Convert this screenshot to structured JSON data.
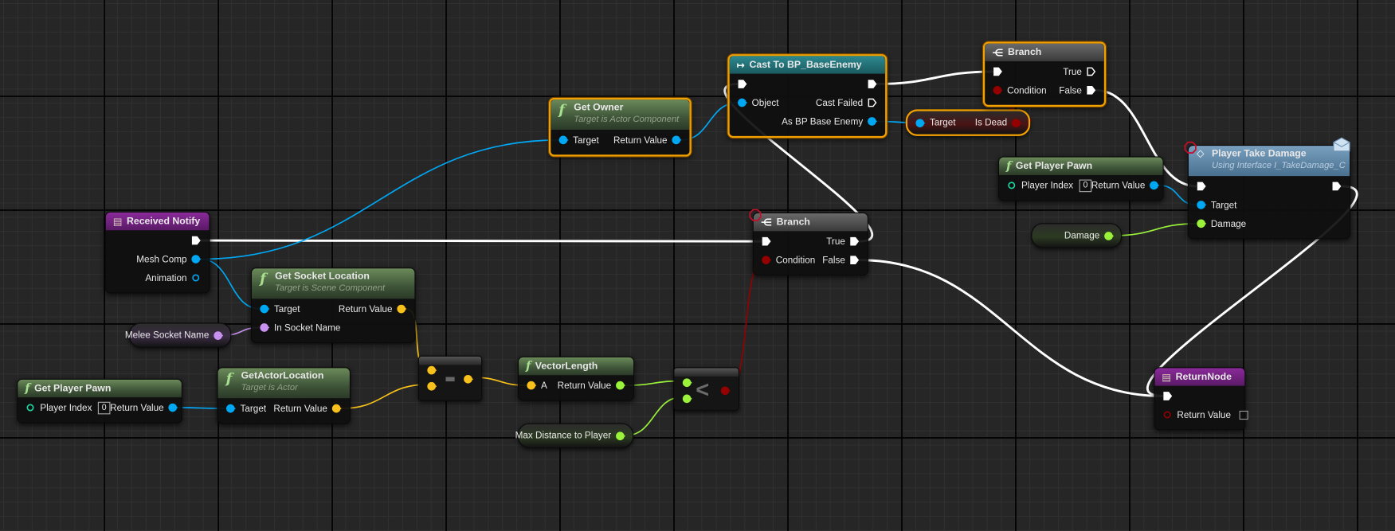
{
  "pin_colors": {
    "exec": "#ffffff",
    "object": "#00a8f4",
    "vector": "#f7c01a",
    "bool": "#950000",
    "float": "#9af23a",
    "name": "#c890f0",
    "int": "#1ed6a0"
  },
  "accent_selected": "#f2a000",
  "breakpoint_color": "#c0102a",
  "nodes": [
    {
      "id": "get_owner",
      "kind": "function",
      "style": "function",
      "icon": "function-icon",
      "icon_glyph": "f",
      "title": "Get Owner",
      "subtitle": "Target is Actor Component",
      "selected": true,
      "rows": [
        {
          "in": {
            "id": "target",
            "label": "Target",
            "type": "object",
            "connected": true
          },
          "out": {
            "id": "ret",
            "label": "Return Value",
            "type": "object",
            "connected": true
          }
        }
      ]
    },
    {
      "id": "cast",
      "kind": "function",
      "style": "cast",
      "icon": "cast-icon",
      "icon_glyph": "↦",
      "title": "Cast To BP_BaseEnemy",
      "selected": true,
      "rows": [
        {
          "in": {
            "id": "exec_in",
            "label": "",
            "type": "exec",
            "connected": true
          },
          "out": {
            "id": "exec_out",
            "label": "",
            "type": "exec",
            "connected": true
          }
        },
        {
          "in": {
            "id": "object",
            "label": "Object",
            "type": "object",
            "connected": true
          },
          "out": {
            "id": "cast_failed",
            "label": "Cast Failed",
            "type": "exec",
            "connected": false
          }
        },
        {
          "out": {
            "id": "as_enemy",
            "label": "As BP Base Enemy",
            "type": "object",
            "connected": true
          }
        }
      ]
    },
    {
      "id": "is_dead",
      "kind": "pure",
      "tint": "#4a1414",
      "selected": true,
      "in": {
        "id": "target",
        "label": "Target",
        "type": "object",
        "connected": true
      },
      "out": {
        "id": "is_dead",
        "label": "Is Dead",
        "type": "bool",
        "connected": true
      }
    },
    {
      "id": "branch_top",
      "kind": "function",
      "style": "branch",
      "icon": "branch-icon",
      "icon_glyph": "⋲",
      "title": "Branch",
      "selected": true,
      "rows": [
        {
          "in": {
            "id": "exec_in",
            "label": "",
            "type": "exec",
            "connected": true
          },
          "out": {
            "id": "true",
            "label": "True",
            "type": "exec",
            "connected": false
          }
        },
        {
          "in": {
            "id": "condition",
            "label": "Condition",
            "type": "bool",
            "connected": true
          },
          "out": {
            "id": "false",
            "label": "False",
            "type": "exec",
            "connected": true
          }
        }
      ]
    },
    {
      "id": "pawn_right",
      "kind": "function",
      "style": "function",
      "icon": "function-icon",
      "icon_glyph": "f",
      "title": "Get Player Pawn",
      "rows": [
        {
          "in": {
            "id": "player_index",
            "label": "Player Index",
            "type": "int",
            "connected": false,
            "default": "0"
          },
          "out": {
            "id": "ret",
            "label": "Return Value",
            "type": "object",
            "connected": true
          }
        }
      ]
    },
    {
      "id": "ptd",
      "kind": "function",
      "style": "interface",
      "icon": "interface-message-icon",
      "icon_glyph": "◇",
      "title": "Player Take Damage",
      "subtitle": "Using Interface I_TakeDamage_C",
      "breakpoint": true,
      "envelope": true,
      "rows": [
        {
          "in": {
            "id": "exec_in",
            "label": "",
            "type": "exec",
            "connected": true
          },
          "out": {
            "id": "exec_out",
            "label": "",
            "type": "exec",
            "connected": true
          }
        },
        {
          "in": {
            "id": "target",
            "label": "Target",
            "type": "object",
            "connected": true
          }
        },
        {
          "in": {
            "id": "damage",
            "label": "Damage",
            "type": "float",
            "connected": true
          }
        }
      ]
    },
    {
      "id": "damage_var",
      "kind": "variable",
      "tint": "#2c3a22",
      "out": {
        "id": "val",
        "label": "Damage",
        "type": "float",
        "connected": true
      }
    },
    {
      "id": "received",
      "kind": "function",
      "style": "event",
      "icon": "event-icon",
      "icon_glyph": "▤",
      "title": "Received Notify",
      "rows": [
        {
          "out": {
            "id": "exec_out",
            "label": "",
            "type": "exec",
            "connected": true
          }
        },
        {
          "out": {
            "id": "mesh_comp",
            "label": "Mesh Comp",
            "type": "object",
            "connected": true
          }
        },
        {
          "out": {
            "id": "animation",
            "label": "Animation",
            "type": "object",
            "connected": false
          }
        }
      ]
    },
    {
      "id": "branch_mid",
      "kind": "function",
      "style": "branch",
      "icon": "branch-icon",
      "icon_glyph": "⋲",
      "title": "Branch",
      "breakpoint": true,
      "rows": [
        {
          "in": {
            "id": "exec_in",
            "label": "",
            "type": "exec",
            "connected": true
          },
          "out": {
            "id": "true",
            "label": "True",
            "type": "exec",
            "connected": true
          }
        },
        {
          "in": {
            "id": "condition",
            "label": "Condition",
            "type": "bool",
            "connected": true
          },
          "out": {
            "id": "false",
            "label": "False",
            "type": "exec",
            "connected": true
          }
        }
      ]
    },
    {
      "id": "socket",
      "kind": "function",
      "style": "function",
      "icon": "function-icon",
      "icon_glyph": "f",
      "title": "Get Socket Location",
      "subtitle": "Target is Scene Component",
      "rows": [
        {
          "in": {
            "id": "target",
            "label": "Target",
            "type": "object",
            "connected": true
          },
          "out": {
            "id": "ret",
            "label": "Return Value",
            "type": "vector",
            "connected": true
          }
        },
        {
          "in": {
            "id": "socket_name",
            "label": "In Socket Name",
            "type": "name",
            "connected": true
          }
        }
      ]
    },
    {
      "id": "melee_var",
      "kind": "variable",
      "tint": "#3a2c44",
      "out": {
        "id": "val",
        "label": "Melee Socket Name",
        "type": "name",
        "connected": true
      }
    },
    {
      "id": "pawn_left",
      "kind": "function",
      "style": "function",
      "icon": "function-icon",
      "icon_glyph": "f",
      "title": "Get Player Pawn",
      "rows": [
        {
          "in": {
            "id": "player_index",
            "label": "Player Index",
            "type": "int",
            "connected": false,
            "default": "0"
          },
          "out": {
            "id": "ret",
            "label": "Return Value",
            "type": "object",
            "connected": true
          }
        }
      ]
    },
    {
      "id": "actor_loc",
      "kind": "function",
      "style": "function",
      "icon": "function-icon",
      "icon_glyph": "f",
      "title": "GetActorLocation",
      "subtitle": "Target is Actor",
      "rows": [
        {
          "in": {
            "id": "target",
            "label": "Target",
            "type": "object",
            "connected": true
          },
          "out": {
            "id": "ret",
            "label": "Return Value",
            "type": "vector",
            "connected": true
          }
        }
      ]
    },
    {
      "id": "subtract",
      "kind": "operator",
      "symbol": "-",
      "type": "vector",
      "inputs": [
        {
          "id": "a",
          "connected": true
        },
        {
          "id": "b",
          "connected": true
        }
      ],
      "out": {
        "id": "ret",
        "connected": true
      }
    },
    {
      "id": "vector_len",
      "kind": "function",
      "style": "function",
      "icon": "function-icon",
      "icon_glyph": "f",
      "title": "VectorLength",
      "rows": [
        {
          "in": {
            "id": "a",
            "label": "A",
            "type": "vector",
            "connected": true
          },
          "out": {
            "id": "ret",
            "label": "Return Value",
            "type": "float",
            "connected": true
          }
        }
      ]
    },
    {
      "id": "less",
      "kind": "operator",
      "symbol": "<",
      "type": "float",
      "out_type": "bool",
      "inputs": [
        {
          "id": "a",
          "connected": true
        },
        {
          "id": "b",
          "connected": true
        }
      ],
      "out": {
        "id": "ret",
        "connected": true
      }
    },
    {
      "id": "max_dist",
      "kind": "variable",
      "tint": "#2c3a22",
      "out": {
        "id": "val",
        "label": "Max Distance to Player",
        "type": "float",
        "connected": true
      }
    },
    {
      "id": "return_node",
      "kind": "function",
      "style": "return",
      "icon": "return-node-icon",
      "icon_glyph": "▤",
      "title": "ReturnNode",
      "rows": [
        {
          "in": {
            "id": "exec_in",
            "label": "",
            "type": "exec",
            "connected": true
          }
        },
        {
          "in": {
            "id": "ret",
            "label": "Return Value",
            "type": "bool",
            "connected": false,
            "checkbox": false
          }
        }
      ]
    }
  ],
  "links": [
    [
      "received.exec_out",
      "branch_mid.exec_in",
      "exec"
    ],
    [
      "branch_mid.true",
      "cast.exec_in",
      "exec"
    ],
    [
      "cast.exec_out",
      "branch_top.exec_in",
      "exec"
    ],
    [
      "branch_top.false",
      "ptd.exec_in",
      "exec"
    ],
    [
      "ptd.exec_out",
      "return_node.exec_in",
      "exec"
    ],
    [
      "branch_mid.false",
      "return_node.exec_in",
      "exec"
    ],
    [
      "received.mesh_comp",
      "get_owner.target",
      "object"
    ],
    [
      "received.mesh_comp",
      "socket.target",
      "object"
    ],
    [
      "get_owner.ret",
      "cast.object",
      "object"
    ],
    [
      "cast.as_enemy",
      "is_dead.target",
      "object"
    ],
    [
      "is_dead.is_dead",
      "branch_top.condition",
      "bool"
    ],
    [
      "pawn_right.ret",
      "ptd.target",
      "object"
    ],
    [
      "damage_var.val",
      "ptd.damage",
      "float"
    ],
    [
      "melee_var.val",
      "socket.socket_name",
      "name"
    ],
    [
      "socket.ret",
      "subtract.a",
      "vector"
    ],
    [
      "actor_loc.ret",
      "subtract.b",
      "vector"
    ],
    [
      "pawn_left.ret",
      "actor_loc.target",
      "object"
    ],
    [
      "subtract.ret",
      "vector_len.a",
      "vector"
    ],
    [
      "vector_len.ret",
      "less.a",
      "float"
    ],
    [
      "max_dist.val",
      "less.b",
      "float"
    ],
    [
      "less.ret",
      "branch_mid.condition",
      "bool"
    ]
  ]
}
